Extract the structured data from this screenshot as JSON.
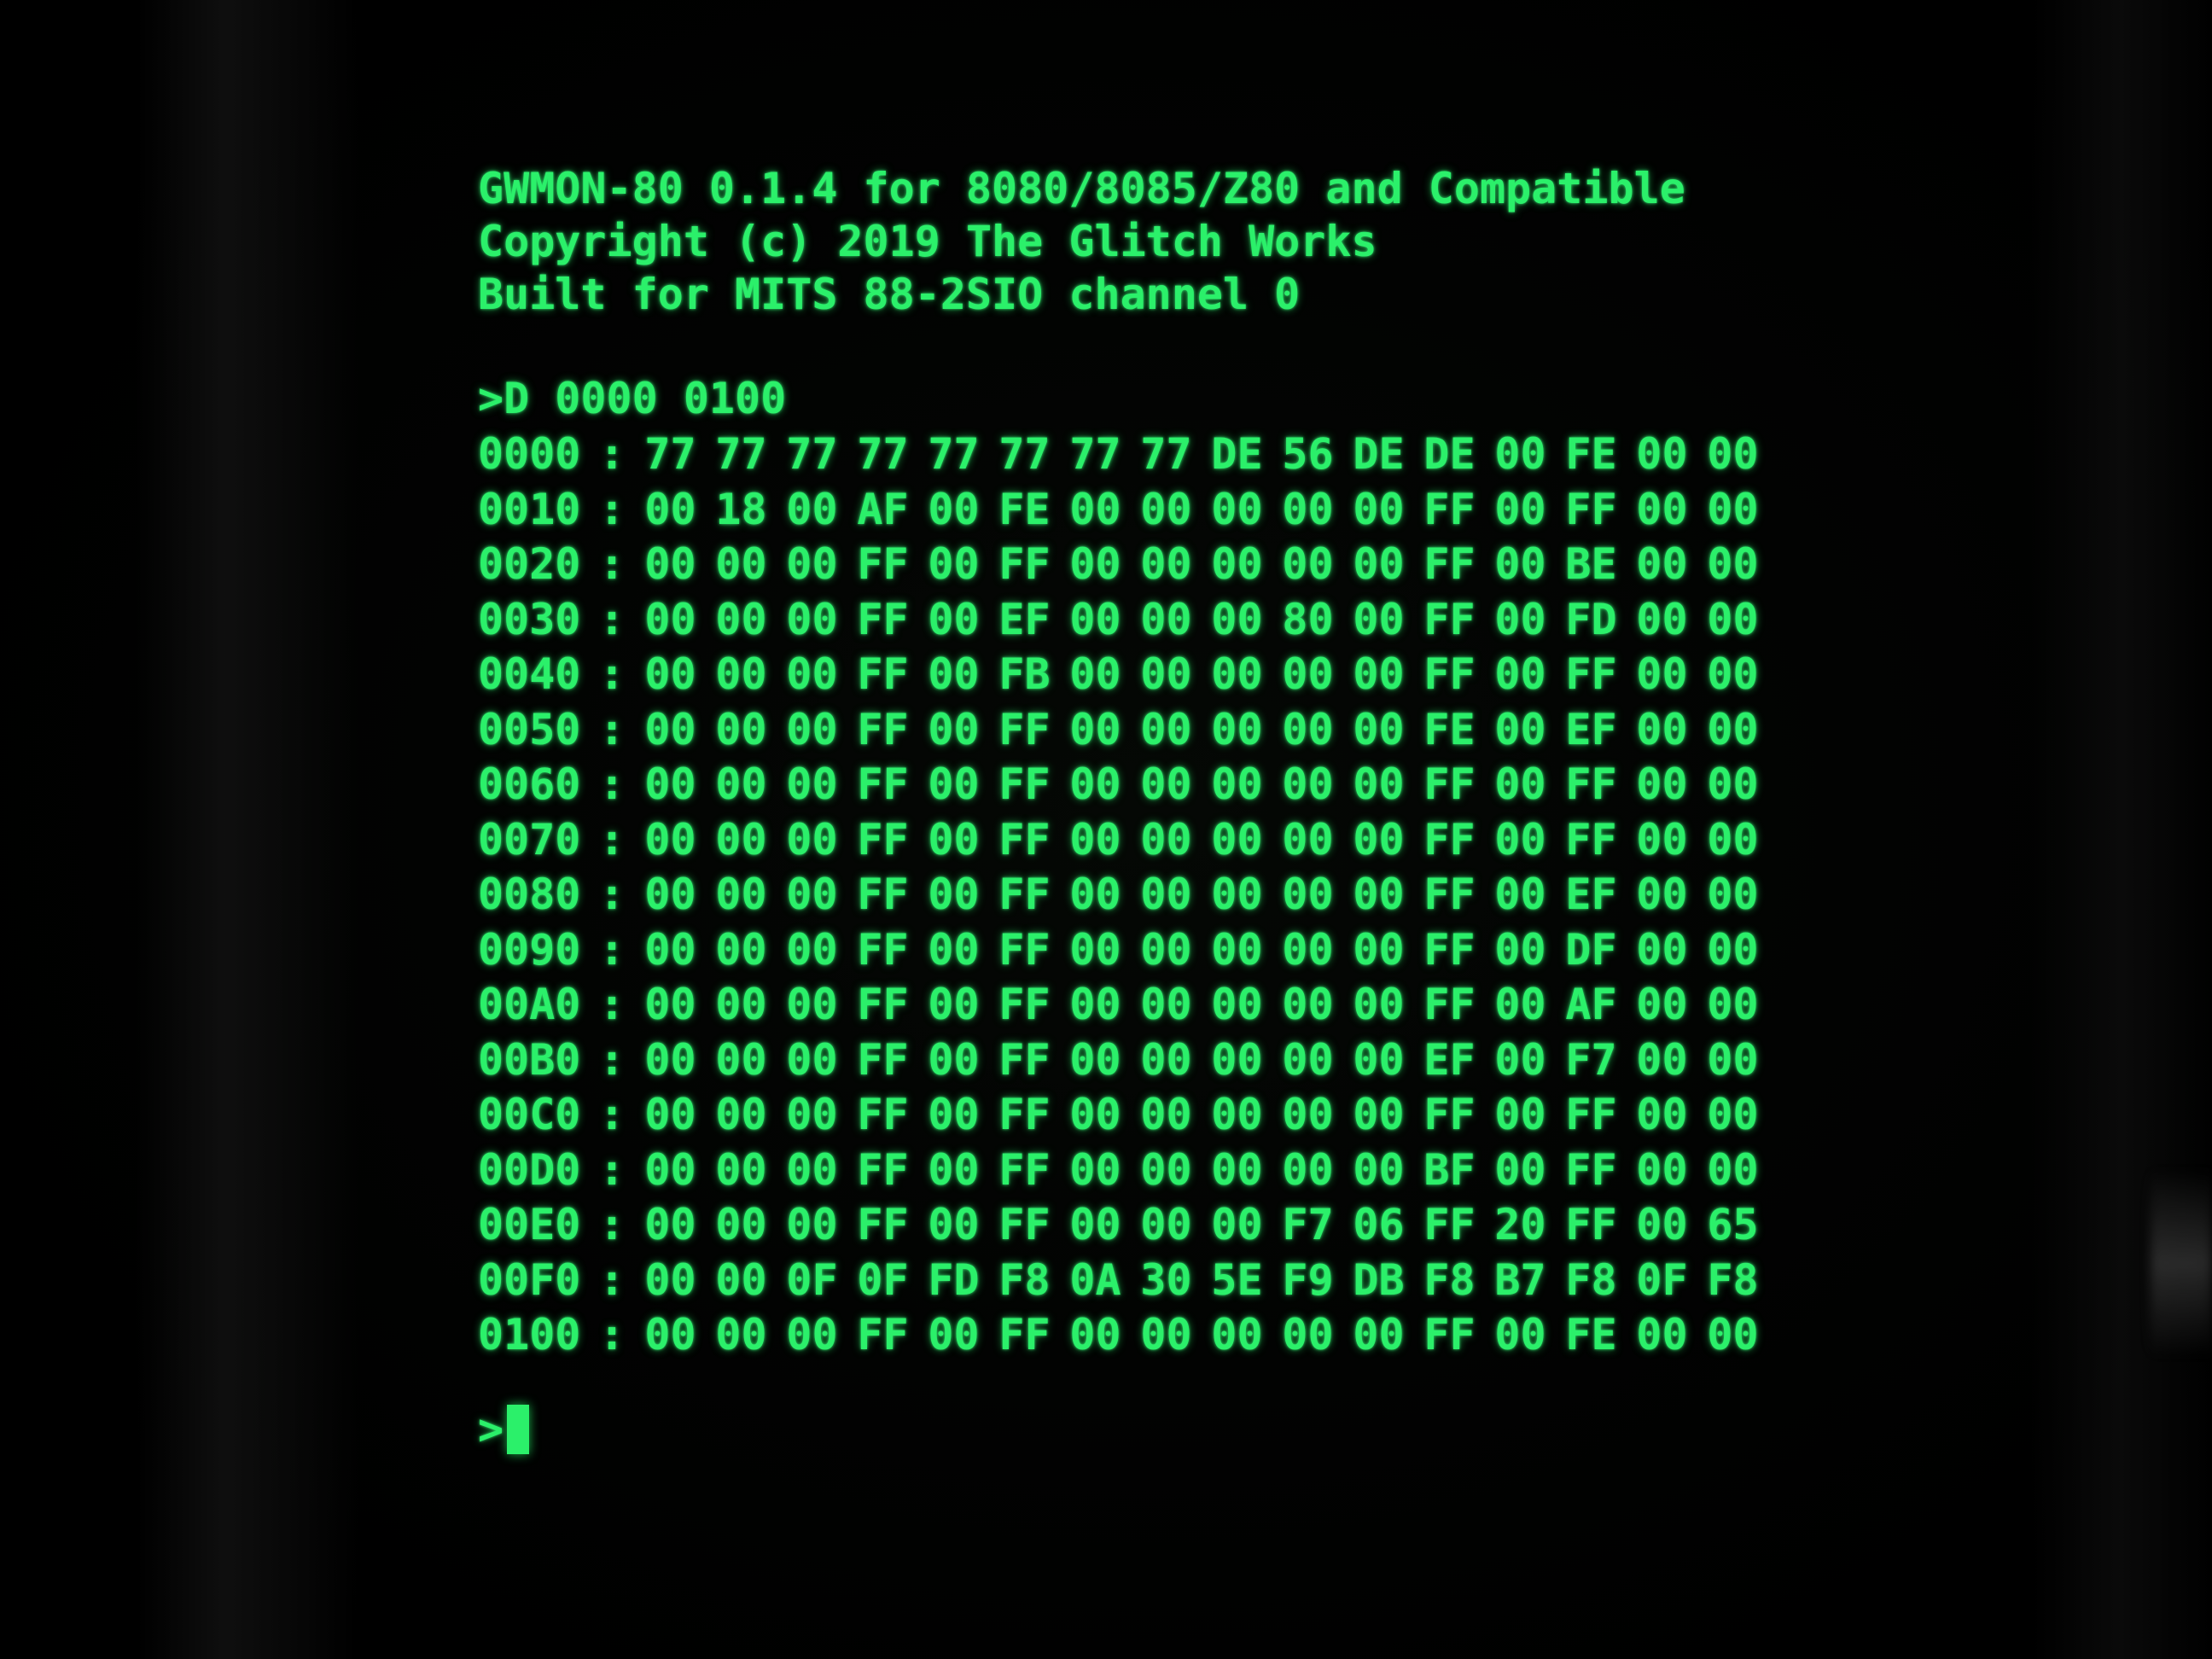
{
  "terminal": {
    "banner": [
      "GWMON-80 0.1.4 for 8080/8085/Z80 and Compatible",
      "Copyright (c) 2019 The Glitch Works",
      "Built for MITS 88-2SIO channel 0"
    ],
    "command": ">D 0000 0100",
    "separator": ":",
    "dump": [
      {
        "addr": "0000",
        "bytes": [
          "77",
          "77",
          "77",
          "77",
          "77",
          "77",
          "77",
          "77",
          "DE",
          "56",
          "DE",
          "DE",
          "00",
          "FE",
          "00",
          "00"
        ]
      },
      {
        "addr": "0010",
        "bytes": [
          "00",
          "18",
          "00",
          "AF",
          "00",
          "FE",
          "00",
          "00",
          "00",
          "00",
          "00",
          "FF",
          "00",
          "FF",
          "00",
          "00"
        ]
      },
      {
        "addr": "0020",
        "bytes": [
          "00",
          "00",
          "00",
          "FF",
          "00",
          "FF",
          "00",
          "00",
          "00",
          "00",
          "00",
          "FF",
          "00",
          "BE",
          "00",
          "00"
        ]
      },
      {
        "addr": "0030",
        "bytes": [
          "00",
          "00",
          "00",
          "FF",
          "00",
          "EF",
          "00",
          "00",
          "00",
          "80",
          "00",
          "FF",
          "00",
          "FD",
          "00",
          "00"
        ]
      },
      {
        "addr": "0040",
        "bytes": [
          "00",
          "00",
          "00",
          "FF",
          "00",
          "FB",
          "00",
          "00",
          "00",
          "00",
          "00",
          "FF",
          "00",
          "FF",
          "00",
          "00"
        ]
      },
      {
        "addr": "0050",
        "bytes": [
          "00",
          "00",
          "00",
          "FF",
          "00",
          "FF",
          "00",
          "00",
          "00",
          "00",
          "00",
          "FE",
          "00",
          "EF",
          "00",
          "00"
        ]
      },
      {
        "addr": "0060",
        "bytes": [
          "00",
          "00",
          "00",
          "FF",
          "00",
          "FF",
          "00",
          "00",
          "00",
          "00",
          "00",
          "FF",
          "00",
          "FF",
          "00",
          "00"
        ]
      },
      {
        "addr": "0070",
        "bytes": [
          "00",
          "00",
          "00",
          "FF",
          "00",
          "FF",
          "00",
          "00",
          "00",
          "00",
          "00",
          "FF",
          "00",
          "FF",
          "00",
          "00"
        ]
      },
      {
        "addr": "0080",
        "bytes": [
          "00",
          "00",
          "00",
          "FF",
          "00",
          "FF",
          "00",
          "00",
          "00",
          "00",
          "00",
          "FF",
          "00",
          "EF",
          "00",
          "00"
        ]
      },
      {
        "addr": "0090",
        "bytes": [
          "00",
          "00",
          "00",
          "FF",
          "00",
          "FF",
          "00",
          "00",
          "00",
          "00",
          "00",
          "FF",
          "00",
          "DF",
          "00",
          "00"
        ]
      },
      {
        "addr": "00A0",
        "bytes": [
          "00",
          "00",
          "00",
          "FF",
          "00",
          "FF",
          "00",
          "00",
          "00",
          "00",
          "00",
          "FF",
          "00",
          "AF",
          "00",
          "00"
        ]
      },
      {
        "addr": "00B0",
        "bytes": [
          "00",
          "00",
          "00",
          "FF",
          "00",
          "FF",
          "00",
          "00",
          "00",
          "00",
          "00",
          "EF",
          "00",
          "F7",
          "00",
          "00"
        ]
      },
      {
        "addr": "00C0",
        "bytes": [
          "00",
          "00",
          "00",
          "FF",
          "00",
          "FF",
          "00",
          "00",
          "00",
          "00",
          "00",
          "FF",
          "00",
          "FF",
          "00",
          "00"
        ]
      },
      {
        "addr": "00D0",
        "bytes": [
          "00",
          "00",
          "00",
          "FF",
          "00",
          "FF",
          "00",
          "00",
          "00",
          "00",
          "00",
          "BF",
          "00",
          "FF",
          "00",
          "00"
        ]
      },
      {
        "addr": "00E0",
        "bytes": [
          "00",
          "00",
          "00",
          "FF",
          "00",
          "FF",
          "00",
          "00",
          "00",
          "F7",
          "06",
          "FF",
          "20",
          "FF",
          "00",
          "65"
        ]
      },
      {
        "addr": "00F0",
        "bytes": [
          "00",
          "00",
          "0F",
          "0F",
          "FD",
          "F8",
          "0A",
          "30",
          "5E",
          "F9",
          "DB",
          "F8",
          "B7",
          "F8",
          "0F",
          "F8"
        ]
      },
      {
        "addr": "0100",
        "bytes": [
          "00",
          "00",
          "00",
          "FF",
          "00",
          "FF",
          "00",
          "00",
          "00",
          "00",
          "00",
          "FF",
          "00",
          "FE",
          "00",
          "00"
        ]
      }
    ],
    "prompt": ">"
  },
  "colors": {
    "phosphor": "#2bf06a",
    "background": "#000000"
  }
}
